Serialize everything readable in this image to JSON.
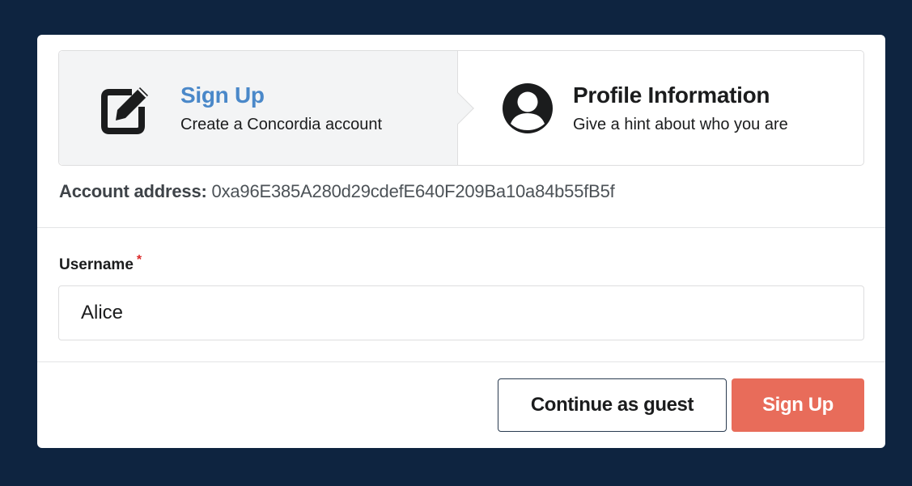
{
  "steps": [
    {
      "title": "Sign Up",
      "description": "Create a Concordia account",
      "icon": "edit-icon",
      "active": true
    },
    {
      "title": "Profile Information",
      "description": "Give a hint about who you are",
      "icon": "user-circle-icon",
      "active": false
    }
  ],
  "account": {
    "label": "Account address:",
    "value": "0xa96E385A280d29cdefE640F209Ba10a84b55fB5f"
  },
  "form": {
    "username_label": "Username",
    "required_marker": "*",
    "username_value": "Alice"
  },
  "buttons": {
    "guest_label": "Continue as guest",
    "signup_label": "Sign Up"
  },
  "colors": {
    "background": "#0e2440",
    "active_step_title": "#4a88c9",
    "primary_button": "#e86c5a",
    "required": "#db2828"
  }
}
